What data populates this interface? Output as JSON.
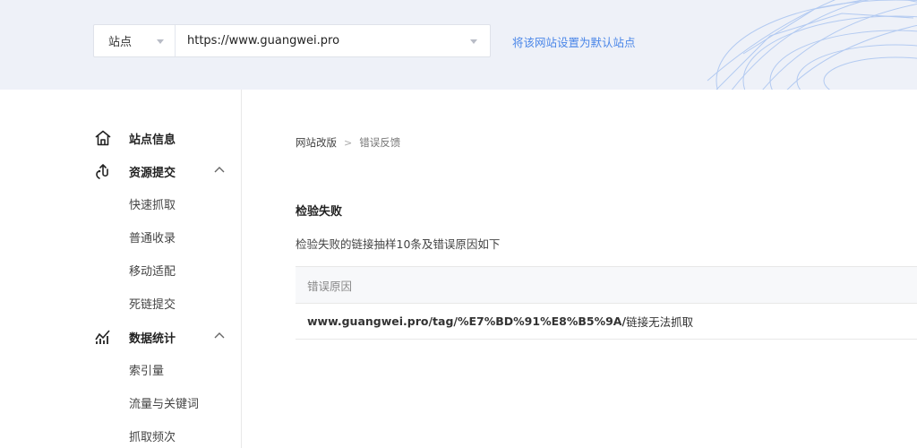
{
  "site_picker": {
    "type_label": "站点",
    "url_value": "https://www.guangwei.pro"
  },
  "default_link": "将该网站设置为默认站点",
  "sidebar": {
    "site_info": "站点信息",
    "resource_submit": {
      "label": "资源提交",
      "items": [
        "快速抓取",
        "普通收录",
        "移动适配",
        "死链提交"
      ]
    },
    "data_stats": {
      "label": "数据统计",
      "items": [
        "索引量",
        "流量与关键词",
        "抓取频次"
      ]
    }
  },
  "breadcrumb": {
    "parent": "网站改版",
    "separator": ">",
    "current": "错误反馈"
  },
  "section": {
    "title": "检验失败",
    "description": "检验失败的链接抽样10条及错误原因如下"
  },
  "table": {
    "header": "错误原因",
    "rows": [
      {
        "url": "www.guangwei.pro/tag/%E7%BD%91%E8%B5%9A/",
        "reason": "链接无法抓取"
      }
    ]
  },
  "colors": {
    "topbar_bg": "#eef1f8",
    "link_blue": "#4a86e8"
  },
  "icons": {
    "site_info": "home-icon",
    "resource_submit": "submit-icon",
    "data_stats": "chart-icon",
    "expand": "chevron-up-icon"
  }
}
